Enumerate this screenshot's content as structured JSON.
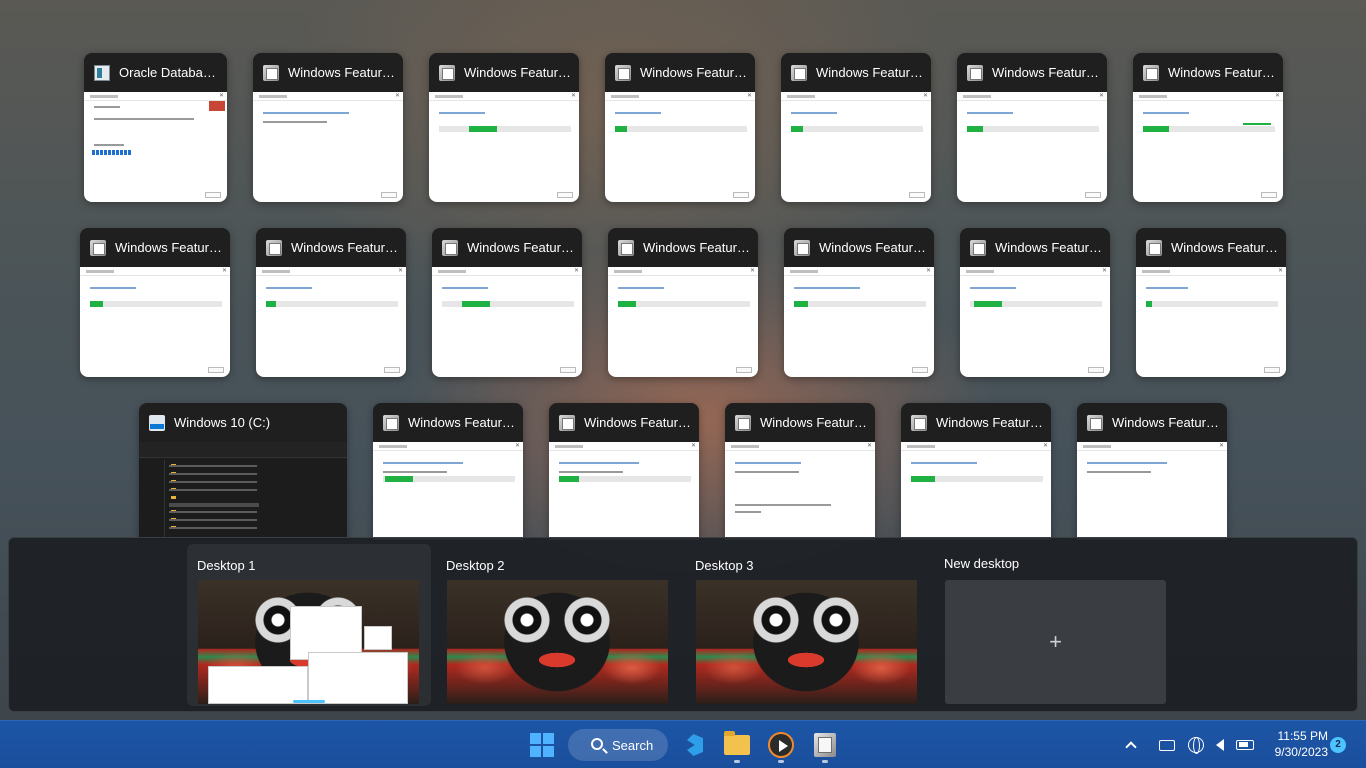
{
  "task_view": {
    "windows_row1": [
      {
        "title": "Oracle Databas...",
        "icon": "oracle-installer-icon"
      },
      {
        "title": "Windows Features",
        "icon": "windows-features-icon"
      },
      {
        "title": "Windows Features",
        "icon": "windows-features-icon"
      },
      {
        "title": "Windows Features",
        "icon": "windows-features-icon"
      },
      {
        "title": "Windows Features",
        "icon": "windows-features-icon"
      },
      {
        "title": "Windows Features",
        "icon": "windows-features-icon"
      },
      {
        "title": "Windows Features",
        "icon": "windows-features-icon"
      }
    ],
    "windows_row2": [
      {
        "title": "Windows Features",
        "icon": "windows-features-icon"
      },
      {
        "title": "Windows Features",
        "icon": "windows-features-icon"
      },
      {
        "title": "Windows Features",
        "icon": "windows-features-icon"
      },
      {
        "title": "Windows Features",
        "icon": "windows-features-icon"
      },
      {
        "title": "Windows Features",
        "icon": "windows-features-icon"
      },
      {
        "title": "Windows Features",
        "icon": "windows-features-icon"
      },
      {
        "title": "Windows Features",
        "icon": "windows-features-icon"
      }
    ],
    "windows_row3": [
      {
        "title": "Windows 10 (C:)",
        "icon": "drive-icon"
      },
      {
        "title": "Windows Features",
        "icon": "windows-features-icon"
      },
      {
        "title": "Windows Features",
        "icon": "windows-features-icon"
      },
      {
        "title": "Windows Features",
        "icon": "windows-features-icon"
      },
      {
        "title": "Windows Features",
        "icon": "windows-features-icon"
      },
      {
        "title": "Windows Features",
        "icon": "windows-features-icon"
      }
    ]
  },
  "desktops": {
    "items": [
      {
        "label": "Desktop 1",
        "current": true
      },
      {
        "label": "Desktop 2",
        "current": false
      },
      {
        "label": "Desktop 3",
        "current": false
      }
    ],
    "new_desktop_label": "New desktop",
    "new_desktop_glyph": "+"
  },
  "taskbar": {
    "search_label": "Search",
    "time": "11:55 PM",
    "date": "9/30/2023",
    "notification_count": "2",
    "accent": "#4cc2ff",
    "background": "#1d55a6"
  }
}
